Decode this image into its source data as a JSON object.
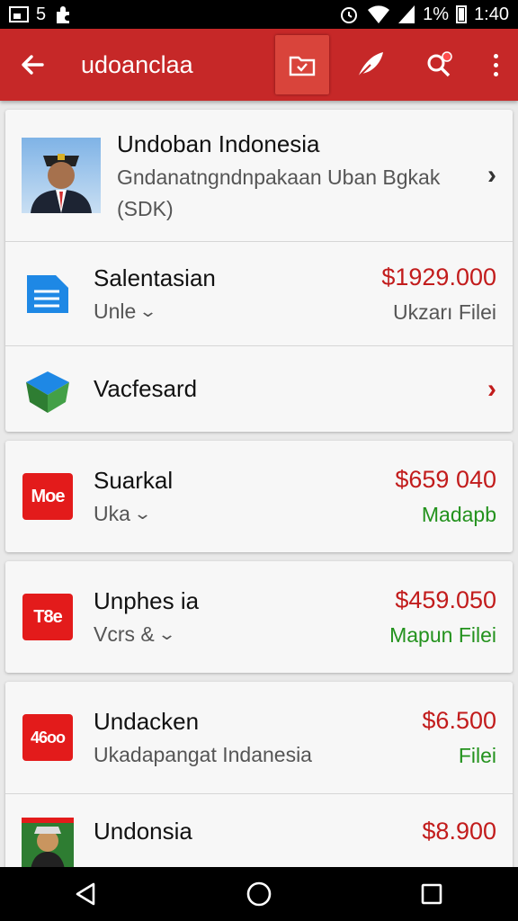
{
  "status_bar": {
    "notif_count": "5",
    "battery": "1%",
    "time": "1:40"
  },
  "app_bar": {
    "title": "udoanclaa"
  },
  "profile": {
    "name": "Undoban Indonesia",
    "subtitle": "Gndanatngndnpakaan Uban Bgkak",
    "code": "(SDK)"
  },
  "items": [
    {
      "name": "Salentasian",
      "sub": "Unle",
      "price": "$1929.000",
      "tag": "Ukzarı Filei"
    },
    {
      "name": "Vacfesard"
    },
    {
      "logo": "Moe",
      "name": "Suarkal",
      "sub": "Uka",
      "price": "$659 040",
      "tag": "Madapb"
    },
    {
      "logo": "T8e",
      "name": "Unphes ia",
      "sub": "Vcrs &",
      "price": "$459.050",
      "tag": "Mapun Filei"
    },
    {
      "logo": "46oo",
      "name": "Undacken",
      "sub": "Ukadapangat Indanesia",
      "price": "$6.500",
      "tag": "Filei"
    },
    {
      "name": "Undonsia",
      "price": "$8.900"
    }
  ],
  "icons": {
    "back": "arrow-left-icon",
    "folder": "folder-icon",
    "edit": "feather-icon",
    "share": "share-icon",
    "more": "more-vert-icon"
  },
  "colors": {
    "primary": "#c62828",
    "price": "#c21c1c",
    "green": "#23921d"
  }
}
